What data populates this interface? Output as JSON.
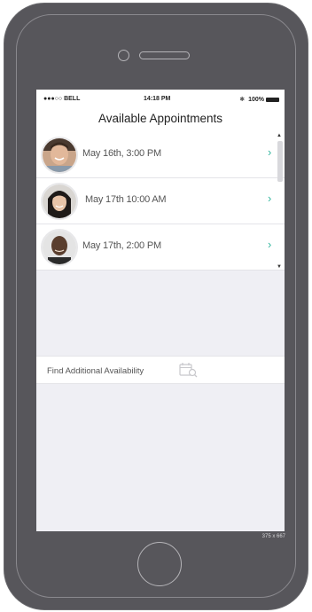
{
  "device": {
    "size_label": "375 x 667"
  },
  "status_bar": {
    "carrier": "●●●○○ BELL",
    "time": "14:18 PM",
    "bluetooth": "✱",
    "battery": "100%"
  },
  "nav": {
    "title": "Available Appointments"
  },
  "appointments": [
    {
      "label": "May 16th, 3:00 PM",
      "avatar": "man-avatar"
    },
    {
      "label": "May 17th 10:00 AM",
      "avatar": "woman-avatar"
    },
    {
      "label": "May 17th, 2:00 PM",
      "avatar": "man-avatar-2"
    }
  ],
  "find": {
    "label": "Find Additional Availability",
    "icon": "calendar-search-icon"
  },
  "colors": {
    "phone": "#57565b",
    "screen_bg": "#efeff4",
    "chevron": "#35b7a0"
  }
}
